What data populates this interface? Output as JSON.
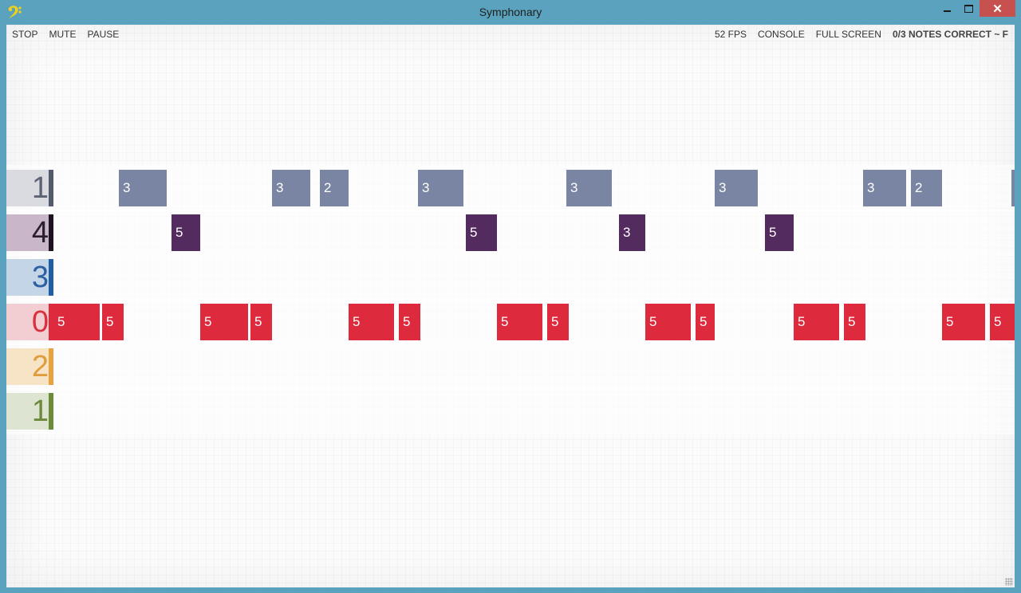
{
  "window": {
    "title": "Symphonary"
  },
  "toolbar": {
    "left": [
      "STOP",
      "MUTE",
      "PAUSE"
    ],
    "fps": "52 FPS",
    "console": "CONSOLE",
    "fullscreen": "FULL SCREEN",
    "status": "0/3 NOTES CORRECT ~ F"
  },
  "lanes": [
    {
      "label": "1",
      "color": "#7a85a3",
      "tint": "#dadbe1",
      "marker": "#535a6e",
      "text": "#5d6274",
      "notes": [
        "3",
        "3",
        "2",
        "3",
        "3",
        "3",
        "3",
        "2"
      ]
    },
    {
      "label": "4",
      "color": "#542b5e",
      "tint": "#c9b6c9",
      "marker": "#1c1220",
      "text": "#2a1d2e",
      "notes": [
        "5",
        "5",
        "3",
        "5"
      ]
    },
    {
      "label": "3",
      "color": "#1f5ea6",
      "tint": "#c4d5e8",
      "marker": "#1f5ea6",
      "text": "#2d60a1",
      "notes": []
    },
    {
      "label": "0",
      "color": "#de2a3d",
      "tint": "#f2cdd1",
      "marker": "#de2a3d",
      "text": "#d8323f",
      "notes": [
        "5",
        "5",
        "5",
        "5",
        "5",
        "5",
        "5",
        "5",
        "5",
        "5",
        "5",
        "5",
        "5",
        "5"
      ]
    },
    {
      "label": "2",
      "color": "#e8a33c",
      "tint": "#f7e3c6",
      "marker": "#e8a33c",
      "text": "#e09d3d",
      "notes": []
    },
    {
      "label": "1",
      "color": "#6a8c36",
      "tint": "#dde5d2",
      "marker": "#6a8c36",
      "text": "#6d8a3c",
      "notes": []
    }
  ],
  "icons": {
    "app": "bass-clef-icon",
    "minimize": "minimize-icon",
    "maximize": "maximize-icon",
    "close": "close-icon"
  }
}
